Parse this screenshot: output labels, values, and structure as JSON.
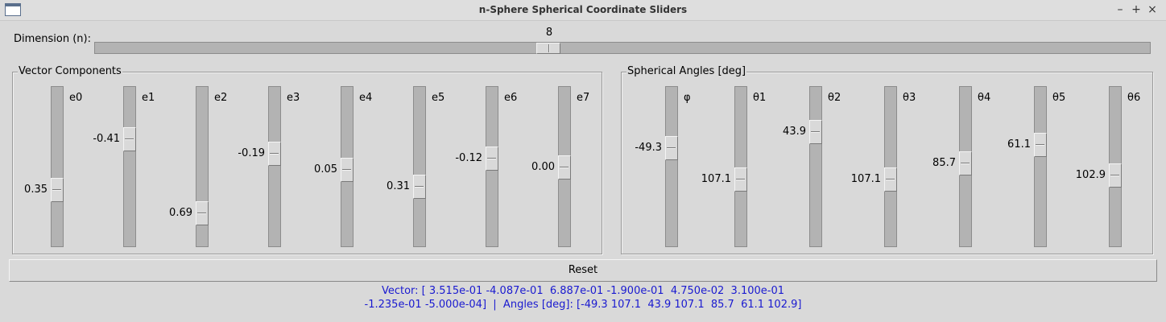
{
  "window": {
    "title": "n-Sphere Spherical Coordinate Sliders",
    "controls": [
      "–",
      "+",
      "×"
    ]
  },
  "dimension": {
    "label": "Dimension (n):",
    "value": "8",
    "level": 0.5
  },
  "vector_frame": {
    "title": "Vector Components",
    "sliders": [
      {
        "label": "e0",
        "value": "0.35"
      },
      {
        "label": "e1",
        "value": "-0.41"
      },
      {
        "label": "e2",
        "value": "0.69"
      },
      {
        "label": "e3",
        "value": "-0.19"
      },
      {
        "label": "e4",
        "value": "0.05"
      },
      {
        "label": "e5",
        "value": "0.31"
      },
      {
        "label": "e6",
        "value": "-0.12"
      },
      {
        "label": "e7",
        "value": "0.00"
      }
    ]
  },
  "angles_frame": {
    "title": "Spherical Angles [deg]",
    "sliders": [
      {
        "label": "φ",
        "value": "-49.3"
      },
      {
        "label": "θ1",
        "value": "107.1"
      },
      {
        "label": "θ2",
        "value": "43.9"
      },
      {
        "label": "θ3",
        "value": "107.1"
      },
      {
        "label": "θ4",
        "value": "85.7"
      },
      {
        "label": "θ5",
        "value": "61.1"
      },
      {
        "label": "θ6",
        "value": "102.9"
      }
    ]
  },
  "reset_label": "Reset",
  "status": {
    "line1": "Vector: [ 3.515e-01 -4.087e-01  6.887e-01 -1.900e-01  4.750e-02  3.100e-01",
    "line2": "-1.235e-01 -5.000e-04]  |  Angles [deg]: [-49.3 107.1  43.9 107.1  85.7  61.1 102.9]"
  },
  "colors": {
    "status_text": "#1a1ad0",
    "background": "#d9d9d9"
  }
}
